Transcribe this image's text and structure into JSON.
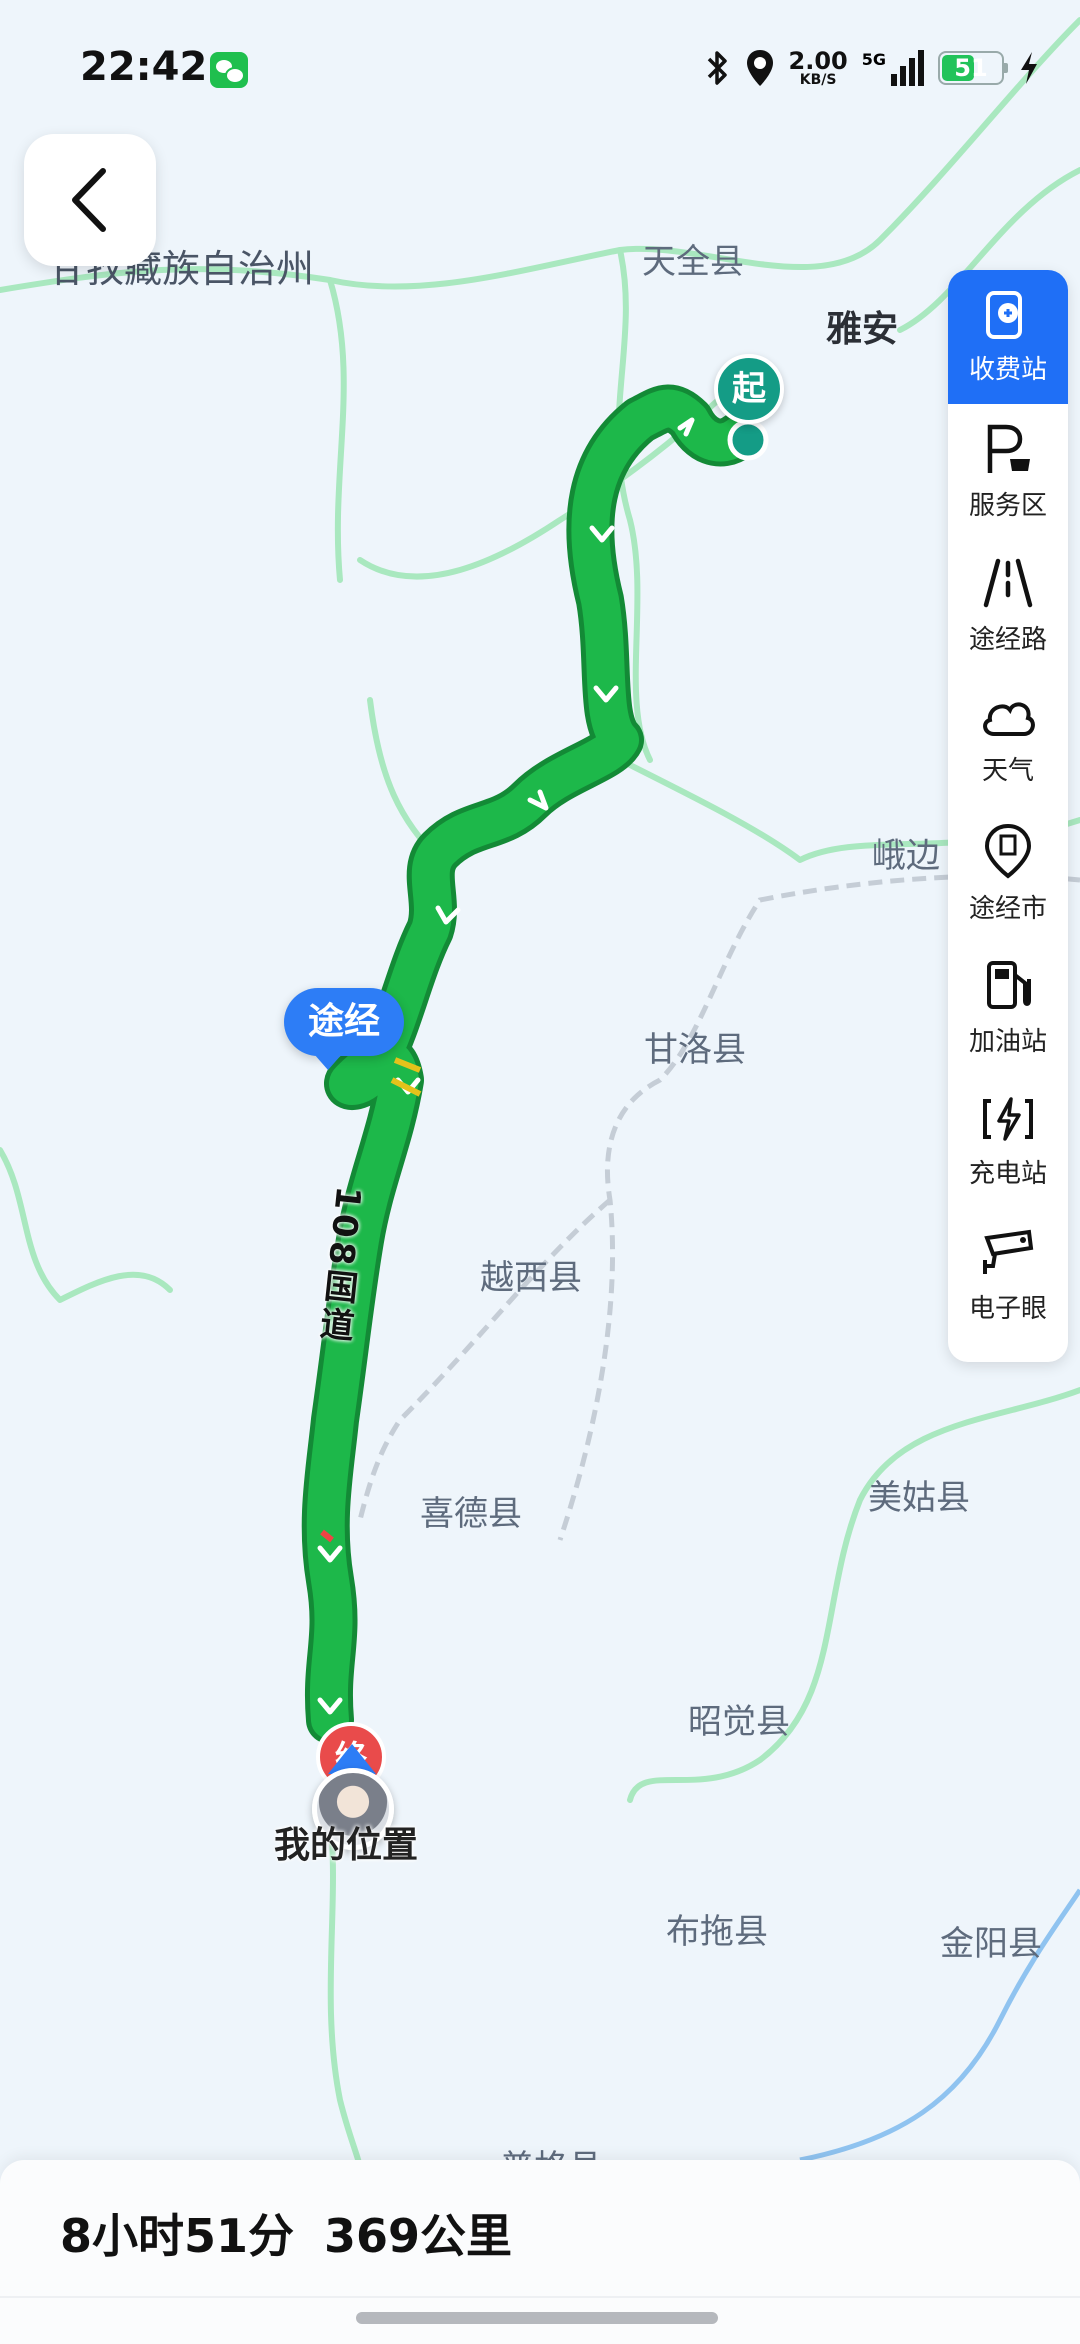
{
  "status_bar": {
    "time": "22:42",
    "net_speed_value": "2.00",
    "net_speed_unit": "KB/S",
    "network": "5G",
    "battery": "51",
    "icons": [
      "wechat-icon",
      "bluetooth-icon",
      "location-icon",
      "signal-icon",
      "charging-icon"
    ]
  },
  "nav": {
    "back_icon": "chevron-left-icon"
  },
  "toolbar": {
    "items": [
      {
        "label": "收费站",
        "icon": "toll-station-icon",
        "active": true
      },
      {
        "label": "服务区",
        "icon": "service-area-icon"
      },
      {
        "label": "途经路",
        "icon": "road-icon"
      },
      {
        "label": "天气",
        "icon": "cloud-icon"
      },
      {
        "label": "途经市",
        "icon": "city-pin-icon"
      },
      {
        "label": "加油站",
        "icon": "fuel-icon"
      },
      {
        "label": "充电站",
        "icon": "charging-station-icon"
      },
      {
        "label": "电子眼",
        "icon": "camera-icon"
      }
    ]
  },
  "map": {
    "labels": {
      "autonomous_prefecture": "甘孜藏族自治州",
      "tianquan": "天全县",
      "yaan": "雅安",
      "ebian": "峨边",
      "ganluo": "甘洛县",
      "yuexi": "越西县",
      "xide": "喜德县",
      "meigu": "美姑县",
      "zhaojue": "昭觉县",
      "butuo": "布拖县",
      "jinyang": "金阳县",
      "puge": "普格县"
    },
    "road_name": "108国道",
    "start_marker": "起",
    "end_marker": "终",
    "via_bubble": "途经",
    "my_location": "我的位置",
    "route_color": "#1db84a"
  },
  "summary": {
    "duration": "8小时51分",
    "distance": "369公里"
  }
}
